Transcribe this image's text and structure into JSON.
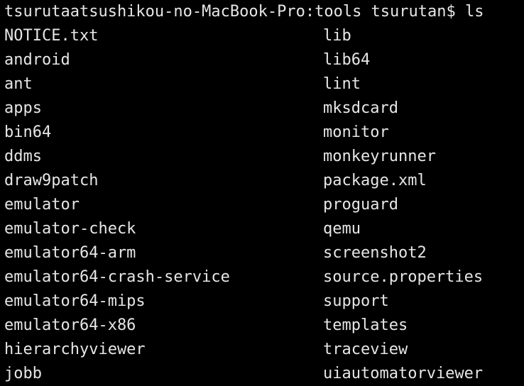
{
  "terminal": {
    "prompt": "tsurutaatsushikou-no-MacBook-Pro:tools tsurutan$ ls",
    "column1": [
      "NOTICE.txt",
      "android",
      "ant",
      "apps",
      "bin64",
      "ddms",
      "draw9patch",
      "emulator",
      "emulator-check",
      "emulator64-arm",
      "emulator64-crash-service",
      "emulator64-mips",
      "emulator64-x86",
      "hierarchyviewer",
      "jobb"
    ],
    "column2": [
      "lib",
      "lib64",
      "lint",
      "mksdcard",
      "monitor",
      "monkeyrunner",
      "package.xml",
      "proguard",
      "qemu",
      "screenshot2",
      "source.properties",
      "support",
      "templates",
      "traceview",
      "uiautomatorviewer"
    ],
    "colors": {
      "background": "#000000",
      "text": "#e6e6e6"
    }
  }
}
